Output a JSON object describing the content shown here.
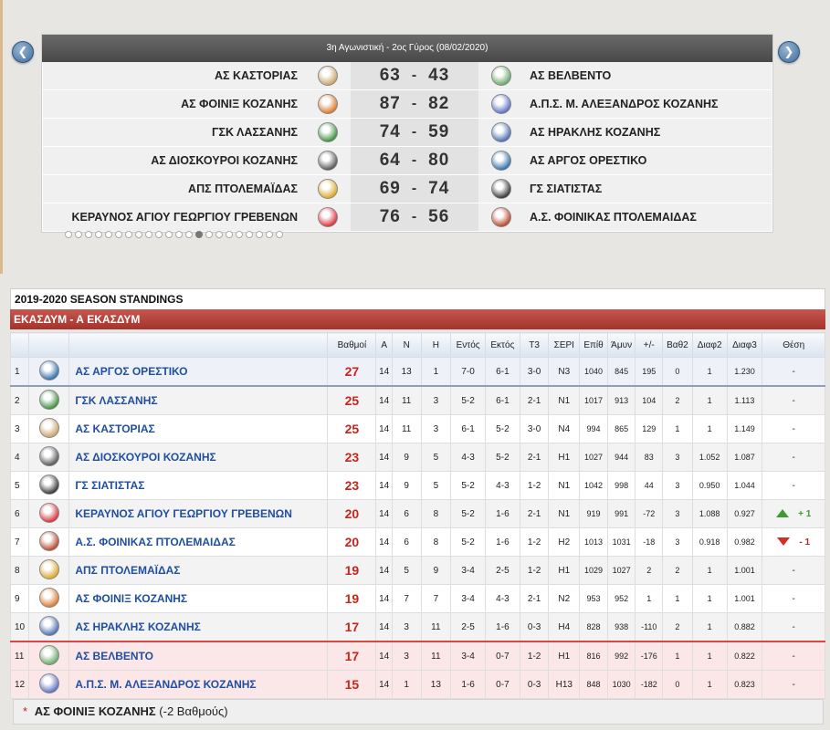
{
  "scoreboard": {
    "header": "3η Αγωνιστική - 2ος Γύρος (08/02/2020)",
    "prev_icon": "chevron-left-icon",
    "next_icon": "chevron-right-icon",
    "games": [
      {
        "home": "ΑΣ ΚΑΣΤΟΡΙΑΣ",
        "home_score": "63",
        "away_score": "43",
        "away": "ΑΣ ΒΕΛΒΕΝΤΟ",
        "home_color": "#c9a36a",
        "away_color": "#6aa86a"
      },
      {
        "home": "ΑΣ ΦΟΙΝΙΞ ΚΟΖΑΝΗΣ",
        "home_score": "87",
        "away_score": "82",
        "away": "Α.Π.Σ. Μ. ΑΛΕΞΑΝΔΡΟΣ ΚΟΖΑΝΗΣ",
        "home_color": "#d9782a",
        "away_color": "#5a6fbf"
      },
      {
        "home": "ΓΣΚ ΛΑΣΣΑΝΗΣ",
        "home_score": "74",
        "away_score": "59",
        "away": "ΑΣ ΗΡΑΚΛΗΣ ΚΟΖΑΝΗΣ",
        "home_color": "#3c8f3c",
        "away_color": "#4a6db0"
      },
      {
        "home": "ΑΣ ΔΙΟΣΚΟΥΡΟΙ ΚΟΖΑΝΗΣ",
        "home_score": "64",
        "away_score": "80",
        "away": "ΑΣ ΑΡΓΟΣ ΟΡΕΣΤΙΚΟ",
        "home_color": "#555555",
        "away_color": "#2f6fa8"
      },
      {
        "home": "ΑΠΣ ΠΤΟΛΕΜΑΪΔΑΣ",
        "home_score": "69",
        "away_score": "74",
        "away": "ΓΣ ΣΙΑΤΙΣΤΑΣ",
        "home_color": "#d9a62a",
        "away_color": "#333333"
      },
      {
        "home": "ΚΕΡΑΥΝΟΣ ΑΓΙΟΥ ΓΕΩΡΓΙΟΥ ΓΡΕΒΕΝΩΝ",
        "home_score": "76",
        "away_score": "56",
        "away": "Α.Σ. ΦΟΙΝΙΚΑΣ ΠΤΟΛΕΜΑΙΔΑΣ",
        "home_color": "#d8303a",
        "away_color": "#b8452a"
      }
    ],
    "pager_count": 22,
    "pager_active_index": 13
  },
  "standings": {
    "title": "2019-2020 SEASON STANDINGS",
    "group": "ΕΚΑΣΔΥΜ - Α ΕΚΑΣΔΥΜ",
    "columns": [
      "Βαθμοί",
      "Α",
      "Ν",
      "Η",
      "Εντός",
      "Εκτός",
      "Τ3",
      "ΣΕΡΙ",
      "Επίθ",
      "Άμυν",
      "+/-",
      "Βαθ2",
      "Διαφ2",
      "Διαφ3",
      "Θέση"
    ],
    "rows": [
      {
        "pos": "1",
        "team": "ΑΣ ΑΡΓΟΣ ΟΡΕΣΤΙΚΟ",
        "pts": "27",
        "a": "14",
        "n": "13",
        "h": "1",
        "home": "7-0",
        "away": "6-1",
        "t3": "3-0",
        "seri": "N3",
        "epith": "1040",
        "amyn": "845",
        "diff": "195",
        "vath2": "0",
        "diaf2": "1",
        "diaf3": "1.230",
        "thesi": "-",
        "logo_color": "#2f6fa8"
      },
      {
        "pos": "2",
        "team": "ΓΣΚ ΛΑΣΣΑΝΗΣ",
        "pts": "25",
        "a": "14",
        "n": "11",
        "h": "3",
        "home": "5-2",
        "away": "6-1",
        "t3": "2-1",
        "seri": "N1",
        "epith": "1017",
        "amyn": "913",
        "diff": "104",
        "vath2": "2",
        "diaf2": "1",
        "diaf3": "1.113",
        "thesi": "-",
        "logo_color": "#3c8f3c"
      },
      {
        "pos": "3",
        "team": "ΑΣ ΚΑΣΤΟΡΙΑΣ",
        "pts": "25",
        "a": "14",
        "n": "11",
        "h": "3",
        "home": "6-1",
        "away": "5-2",
        "t3": "3-0",
        "seri": "N4",
        "epith": "994",
        "amyn": "865",
        "diff": "129",
        "vath2": "1",
        "diaf2": "1",
        "diaf3": "1.149",
        "thesi": "-",
        "logo_color": "#c9a36a"
      },
      {
        "pos": "4",
        "team": "ΑΣ ΔΙΟΣΚΟΥΡΟΙ ΚΟΖΑΝΗΣ",
        "pts": "23",
        "a": "14",
        "n": "9",
        "h": "5",
        "home": "4-3",
        "away": "5-2",
        "t3": "2-1",
        "seri": "H1",
        "epith": "1027",
        "amyn": "944",
        "diff": "83",
        "vath2": "3",
        "diaf2": "1.052",
        "diaf3": "1.087",
        "thesi": "-",
        "logo_color": "#555555"
      },
      {
        "pos": "5",
        "team": "ΓΣ ΣΙΑΤΙΣΤΑΣ",
        "pts": "23",
        "a": "14",
        "n": "9",
        "h": "5",
        "home": "5-2",
        "away": "4-3",
        "t3": "1-2",
        "seri": "N1",
        "epith": "1042",
        "amyn": "998",
        "diff": "44",
        "vath2": "3",
        "diaf2": "0.950",
        "diaf3": "1.044",
        "thesi": "-",
        "logo_color": "#333333"
      },
      {
        "pos": "6",
        "team": "ΚΕΡΑΥΝΟΣ ΑΓΙΟΥ ΓΕΩΡΓΙΟΥ ΓΡΕΒΕΝΩΝ",
        "pts": "20",
        "a": "14",
        "n": "6",
        "h": "8",
        "home": "5-2",
        "away": "1-6",
        "t3": "2-1",
        "seri": "N1",
        "epith": "919",
        "amyn": "991",
        "diff": "-72",
        "vath2": "3",
        "diaf2": "1.088",
        "diaf3": "0.927",
        "thesi": "+ 1",
        "trend": "up",
        "logo_color": "#d8303a"
      },
      {
        "pos": "7",
        "team": "Α.Σ. ΦΟΙΝΙΚΑΣ ΠΤΟΛΕΜΑΙΔΑΣ",
        "pts": "20",
        "a": "14",
        "n": "6",
        "h": "8",
        "home": "5-2",
        "away": "1-6",
        "t3": "1-2",
        "seri": "H2",
        "epith": "1013",
        "amyn": "1031",
        "diff": "-18",
        "vath2": "3",
        "diaf2": "0.918",
        "diaf3": "0.982",
        "thesi": "- 1",
        "trend": "down",
        "logo_color": "#b8452a"
      },
      {
        "pos": "8",
        "team": "ΑΠΣ ΠΤΟΛΕΜΑΪΔΑΣ",
        "pts": "19",
        "a": "14",
        "n": "5",
        "h": "9",
        "home": "3-4",
        "away": "2-5",
        "t3": "1-2",
        "seri": "H1",
        "epith": "1029",
        "amyn": "1027",
        "diff": "2",
        "vath2": "2",
        "diaf2": "1",
        "diaf3": "1.001",
        "thesi": "-",
        "logo_color": "#d9a62a"
      },
      {
        "pos": "9",
        "team": "ΑΣ ΦΟΙΝΙΞ ΚΟΖΑΝΗΣ",
        "pts": "19",
        "a": "14",
        "n": "7",
        "h": "7",
        "home": "3-4",
        "away": "4-3",
        "t3": "2-1",
        "seri": "N2",
        "epith": "953",
        "amyn": "952",
        "diff": "1",
        "vath2": "1",
        "diaf2": "1",
        "diaf3": "1.001",
        "thesi": "-",
        "logo_color": "#d9782a"
      },
      {
        "pos": "10",
        "team": "ΑΣ ΗΡΑΚΛΗΣ ΚΟΖΑΝΗΣ",
        "pts": "17",
        "a": "14",
        "n": "3",
        "h": "11",
        "home": "2-5",
        "away": "1-6",
        "t3": "0-3",
        "seri": "H4",
        "epith": "828",
        "amyn": "938",
        "diff": "-110",
        "vath2": "2",
        "diaf2": "1",
        "diaf3": "0.882",
        "thesi": "-",
        "logo_color": "#4a6db0"
      },
      {
        "pos": "11",
        "team": "ΑΣ ΒΕΛΒΕΝΤΟ",
        "pts": "17",
        "a": "14",
        "n": "3",
        "h": "11",
        "home": "3-4",
        "away": "0-7",
        "t3": "1-2",
        "seri": "H1",
        "epith": "816",
        "amyn": "992",
        "diff": "-176",
        "vath2": "1",
        "diaf2": "1",
        "diaf3": "0.822",
        "thesi": "-",
        "logo_color": "#6aa86a"
      },
      {
        "pos": "12",
        "team": "Α.Π.Σ. Μ. ΑΛΕΞΑΝΔΡΟΣ ΚΟΖΑΝΗΣ",
        "pts": "15",
        "a": "14",
        "n": "1",
        "h": "13",
        "home": "1-6",
        "away": "0-7",
        "t3": "0-3",
        "seri": "H13",
        "epith": "848",
        "amyn": "1030",
        "diff": "-182",
        "vath2": "0",
        "diaf2": "1",
        "diaf3": "0.823",
        "thesi": "-",
        "logo_color": "#5a6fbf"
      }
    ]
  },
  "footnote": {
    "marker": "*",
    "team": "ΑΣ ΦΟΙΝΙΞ ΚΟΖΑΝΗΣ",
    "note": "(-2 Βαθμούς)"
  },
  "colors": {
    "accent_red": "#c4261d",
    "team_blue": "#1f4ea3",
    "group_bar": "#b0413a",
    "up_green": "#3f9b2e",
    "down_red": "#d0302a"
  }
}
